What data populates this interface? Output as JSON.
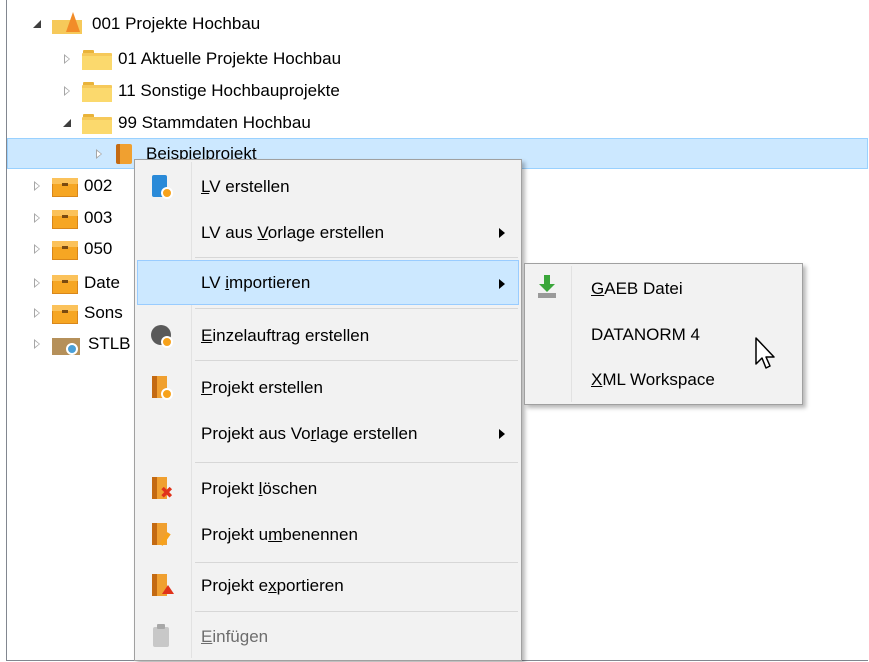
{
  "tree": {
    "nodes": [
      {
        "label": "001 Projekte Hochbau"
      },
      {
        "label": "01 Aktuelle Projekte Hochbau"
      },
      {
        "label": "11 Sonstige Hochbauprojekte"
      },
      {
        "label": "99 Stammdaten Hochbau"
      },
      {
        "label": "Beispielprojekt"
      },
      {
        "label": "002"
      },
      {
        "label": "003"
      },
      {
        "label": "050"
      },
      {
        "label": "Date"
      },
      {
        "label": "Sons"
      },
      {
        "label": "STLB"
      }
    ],
    "selected_color": "#cce8ff"
  },
  "context_menu": {
    "items": [
      {
        "pre": "",
        "u": "L",
        "post": "V erstellen"
      },
      {
        "pre": "LV aus ",
        "u": "V",
        "post": "orlage erstellen"
      },
      {
        "pre": "LV ",
        "u": "i",
        "post": "mportieren"
      },
      {
        "pre": "",
        "u": "E",
        "post": "inzelauftrag erstellen"
      },
      {
        "pre": "",
        "u": "P",
        "post": "rojekt erstellen"
      },
      {
        "pre": "Projekt aus Vo",
        "u": "r",
        "post": "lage erstellen"
      },
      {
        "pre": "Projekt ",
        "u": "l",
        "post": "öschen"
      },
      {
        "pre": "Projekt u",
        "u": "m",
        "post": "benennen"
      },
      {
        "pre": "Projekt e",
        "u": "x",
        "post": "portieren"
      },
      {
        "pre": "",
        "u": "E",
        "post": "infügen"
      }
    ],
    "background": "#f2f2f2",
    "highlight": "#cce8ff"
  },
  "submenu": {
    "items": [
      {
        "pre": "",
        "u": "G",
        "post": "AEB Datei"
      },
      {
        "pre": "DATANORM 4",
        "u": "",
        "post": ""
      },
      {
        "pre": "",
        "u": "X",
        "post": "ML Workspace"
      }
    ]
  }
}
